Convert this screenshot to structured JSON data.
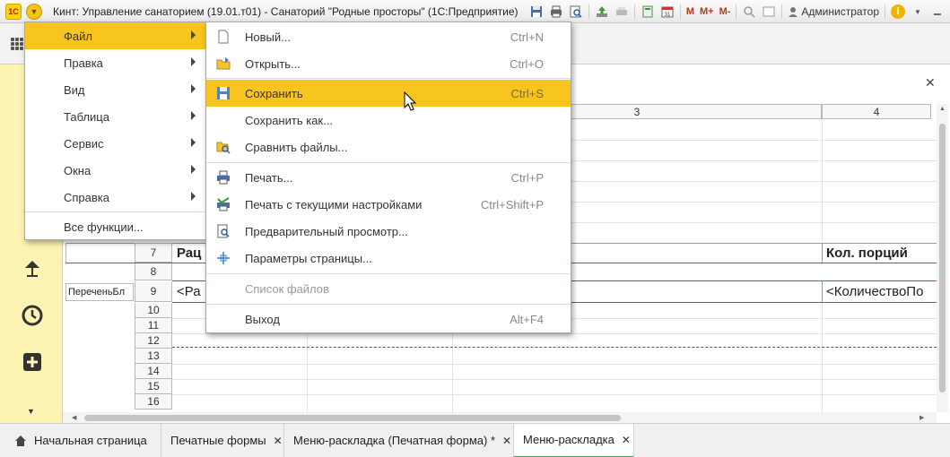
{
  "titlebar": {
    "logo_text": "1С",
    "app_title": "Кинт: Управление санаторием (19.01.т01) - Санаторий \"Родные просторы\" (1С:Предприятие)",
    "m_label": "M",
    "mplus_label": "M+",
    "mminus_label": "M-",
    "user_name": "Администратор",
    "info_label": "i"
  },
  "menu_main": {
    "items": [
      {
        "label": "Файл"
      },
      {
        "label": "Правка"
      },
      {
        "label": "Вид"
      },
      {
        "label": "Таблица"
      },
      {
        "label": "Сервис"
      },
      {
        "label": "Окна"
      },
      {
        "label": "Справка"
      }
    ],
    "all_functions": "Все функции..."
  },
  "menu_file": {
    "items": [
      {
        "label": "Новый...",
        "shortcut": "Ctrl+N"
      },
      {
        "label": "Открыть...",
        "shortcut": "Ctrl+O"
      },
      {
        "label": "Сохранить",
        "shortcut": "Ctrl+S"
      },
      {
        "label": "Сохранить как...",
        "shortcut": ""
      },
      {
        "label": "Сравнить файлы...",
        "shortcut": ""
      },
      {
        "label": "Печать...",
        "shortcut": "Ctrl+P"
      },
      {
        "label": "Печать с текущими настройками",
        "shortcut": "Ctrl+Shift+P"
      },
      {
        "label": "Предварительный просмотр...",
        "shortcut": ""
      },
      {
        "label": "Параметры страницы...",
        "shortcut": ""
      },
      {
        "label": "Список файлов",
        "shortcut": ""
      },
      {
        "label": "Выход",
        "shortcut": "Alt+F4"
      }
    ]
  },
  "sheet": {
    "col3": "3",
    "col4": "4",
    "rows": [
      "7",
      "8",
      "9",
      "10",
      "11",
      "12",
      "13",
      "14",
      "15",
      "16"
    ],
    "cell_racion": "Рац",
    "cell_kol": "Кол. порций",
    "cell_ra_param": "<Ра",
    "cell_kol_param": "<КоличествоПо",
    "cell_perechen": "ПереченьБл"
  },
  "tabs": [
    {
      "label": "Начальная страница"
    },
    {
      "label": "Печатные формы"
    },
    {
      "label": "Меню-раскладка (Печатная форма) *"
    },
    {
      "label": "Меню-раскладка"
    }
  ],
  "colors": {
    "accent": "#f7c51e",
    "sidebar": "#fdf3b3",
    "tab_active_underline": "#3a9b5a"
  }
}
